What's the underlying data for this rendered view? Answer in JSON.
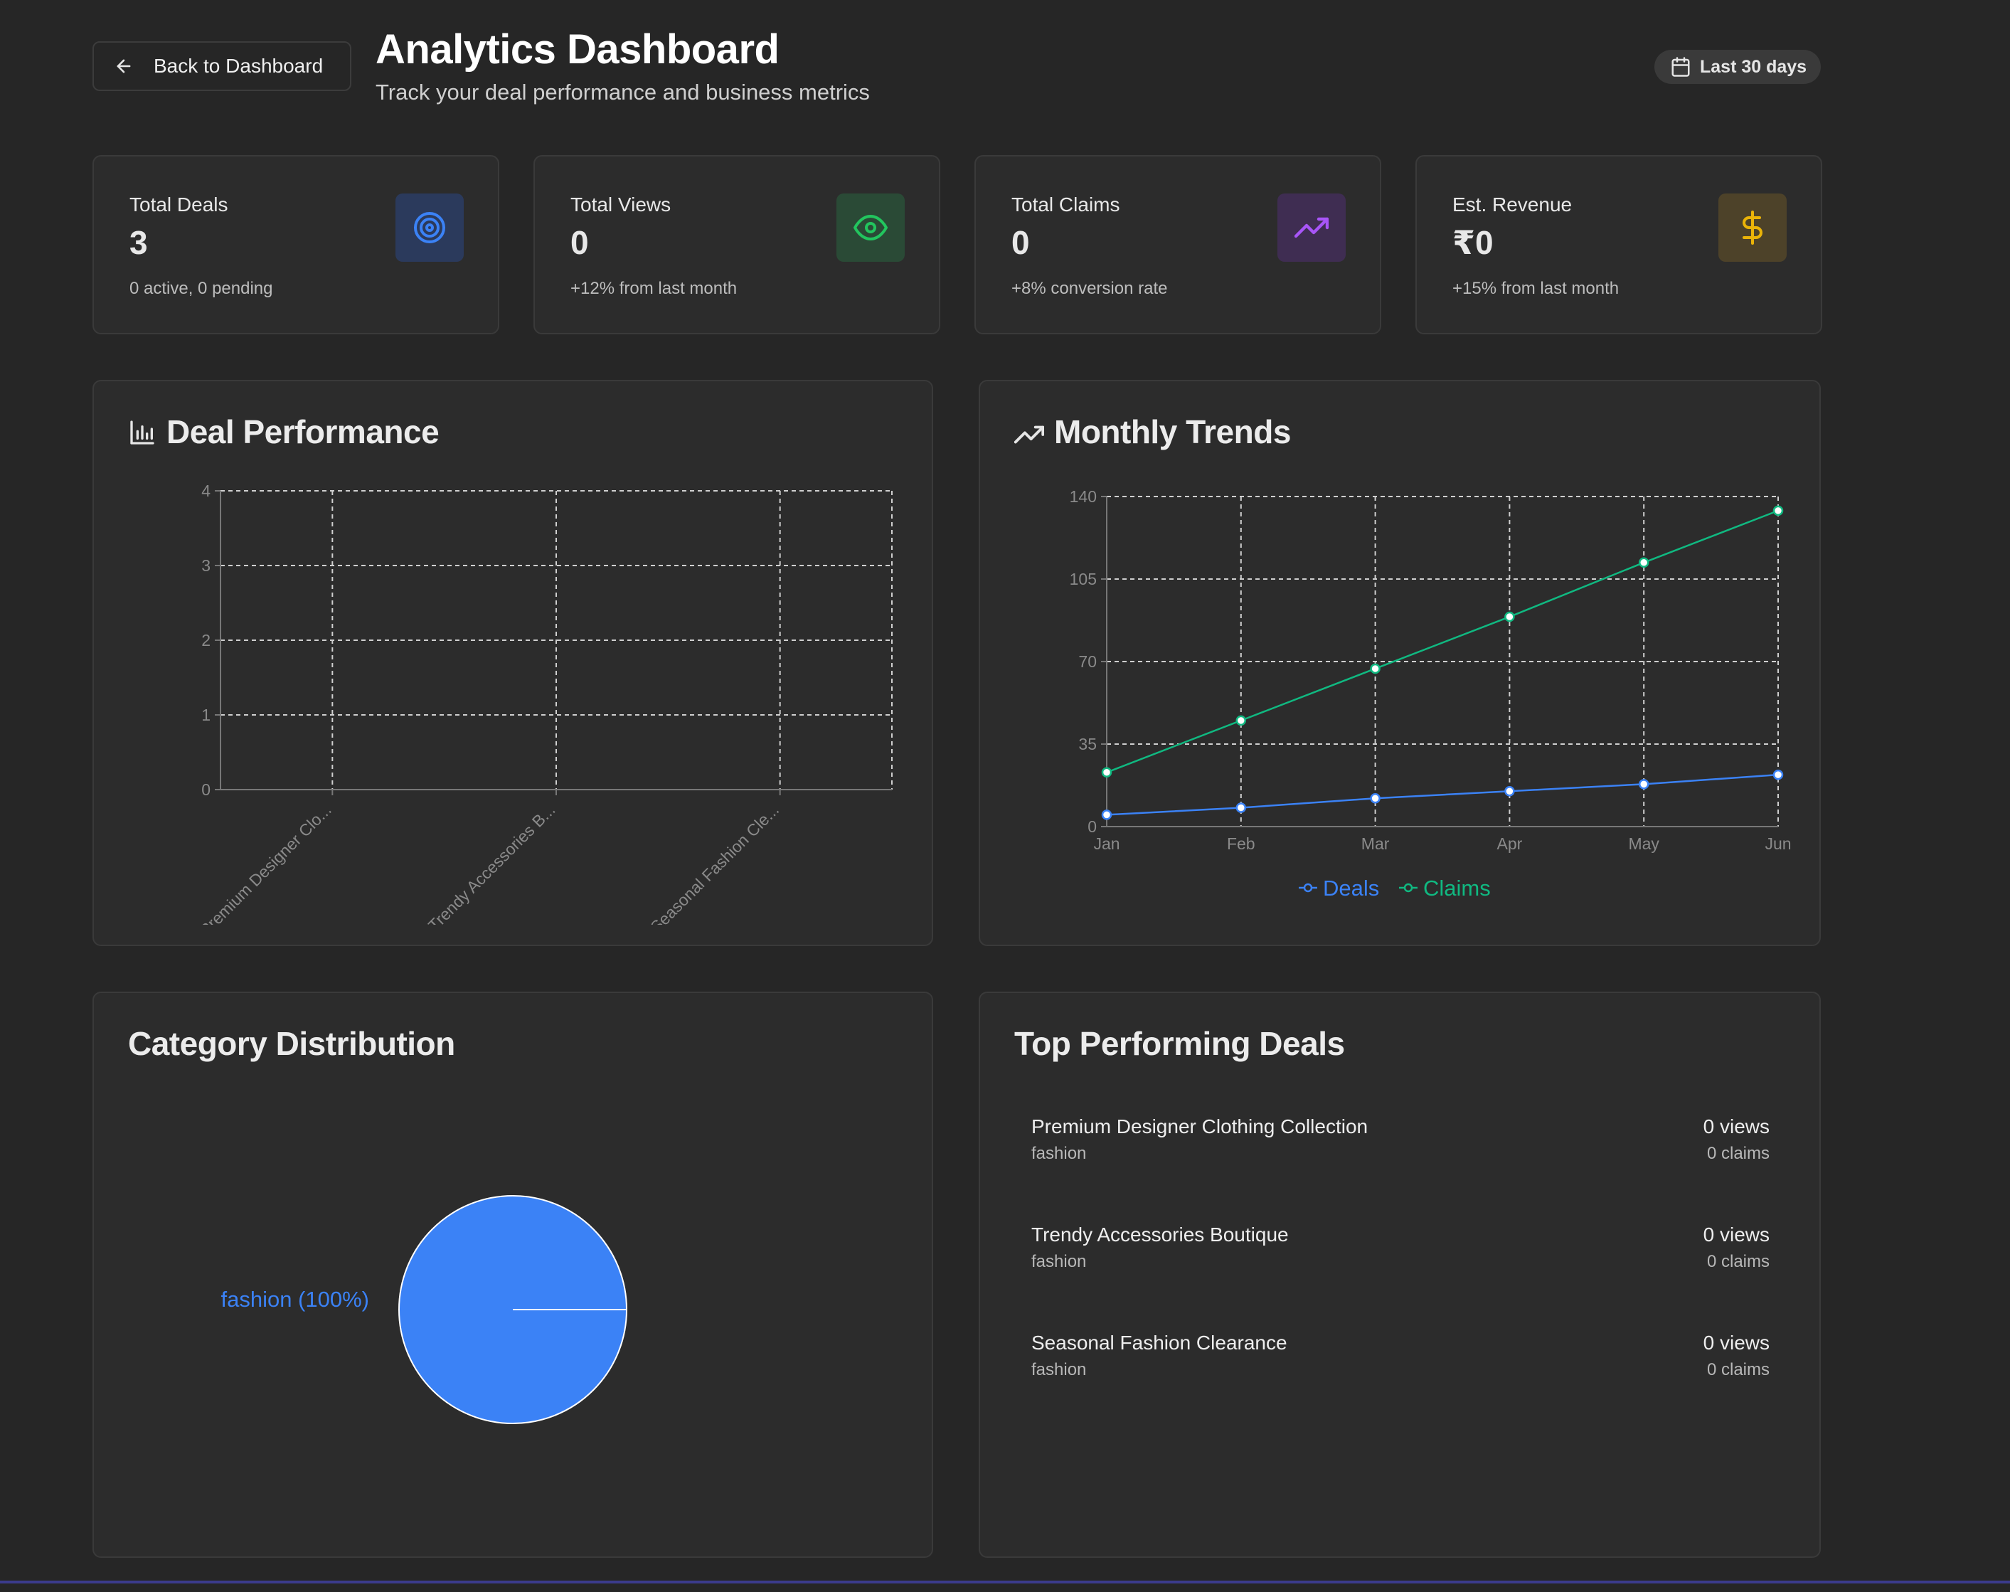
{
  "header": {
    "back_label": "Back to Dashboard",
    "title": "Analytics Dashboard",
    "subtitle": "Track your deal performance and business metrics",
    "date_range": "Last 30 days"
  },
  "stats": [
    {
      "label": "Total Deals",
      "value": "3",
      "note": "0 active, 0 pending",
      "icon": "target-icon",
      "icon_color": "#3b82f6",
      "icon_bg": "#2b3a5c"
    },
    {
      "label": "Total Views",
      "value": "0",
      "note": "+12% from last month",
      "icon": "eye-icon",
      "icon_color": "#22c55e",
      "icon_bg": "#2a4a36"
    },
    {
      "label": "Total Claims",
      "value": "0",
      "note": "+8% conversion rate",
      "icon": "trending-up-icon",
      "icon_color": "#a855f7",
      "icon_bg": "#3f2d52"
    },
    {
      "label": "Est. Revenue",
      "value": "₹0",
      "note": "+15% from last month",
      "icon": "dollar-icon",
      "icon_color": "#eab308",
      "icon_bg": "#4d4229"
    }
  ],
  "panels": {
    "deal_performance": "Deal Performance",
    "monthly_trends": "Monthly Trends",
    "category_distribution": "Category Distribution",
    "top_deals": "Top Performing Deals"
  },
  "chart_data": [
    {
      "type": "bar",
      "title": "Deal Performance",
      "categories": [
        "Premium Designer Clo...",
        "Trendy Accessories B...",
        "Seasonal Fashion Cle..."
      ],
      "values": [
        0,
        0,
        0
      ],
      "ylim": [
        0,
        4
      ],
      "yticks": [
        0,
        1,
        2,
        3,
        4
      ],
      "grid": true
    },
    {
      "type": "line",
      "title": "Monthly Trends",
      "x": [
        "Jan",
        "Feb",
        "Mar",
        "Apr",
        "May",
        "Jun"
      ],
      "series": [
        {
          "name": "Deals",
          "color": "#3b82f6",
          "values": [
            5,
            8,
            12,
            15,
            18,
            22
          ]
        },
        {
          "name": "Claims",
          "color": "#10b981",
          "values": [
            23,
            45,
            67,
            89,
            112,
            134
          ]
        }
      ],
      "ylim": [
        0,
        140
      ],
      "yticks": [
        0,
        35,
        70,
        105,
        140
      ],
      "grid": true,
      "legend": "bottom"
    },
    {
      "type": "pie",
      "title": "Category Distribution",
      "slices": [
        {
          "label": "fashion (100%)",
          "value": 100,
          "color": "#3b82f6"
        }
      ]
    }
  ],
  "top_deals": [
    {
      "name": "Premium Designer Clothing Collection",
      "category": "fashion",
      "views": "0 views",
      "claims": "0 claims"
    },
    {
      "name": "Trendy Accessories Boutique",
      "category": "fashion",
      "views": "0 views",
      "claims": "0 claims"
    },
    {
      "name": "Seasonal Fashion Clearance",
      "category": "fashion",
      "views": "0 views",
      "claims": "0 claims"
    }
  ]
}
